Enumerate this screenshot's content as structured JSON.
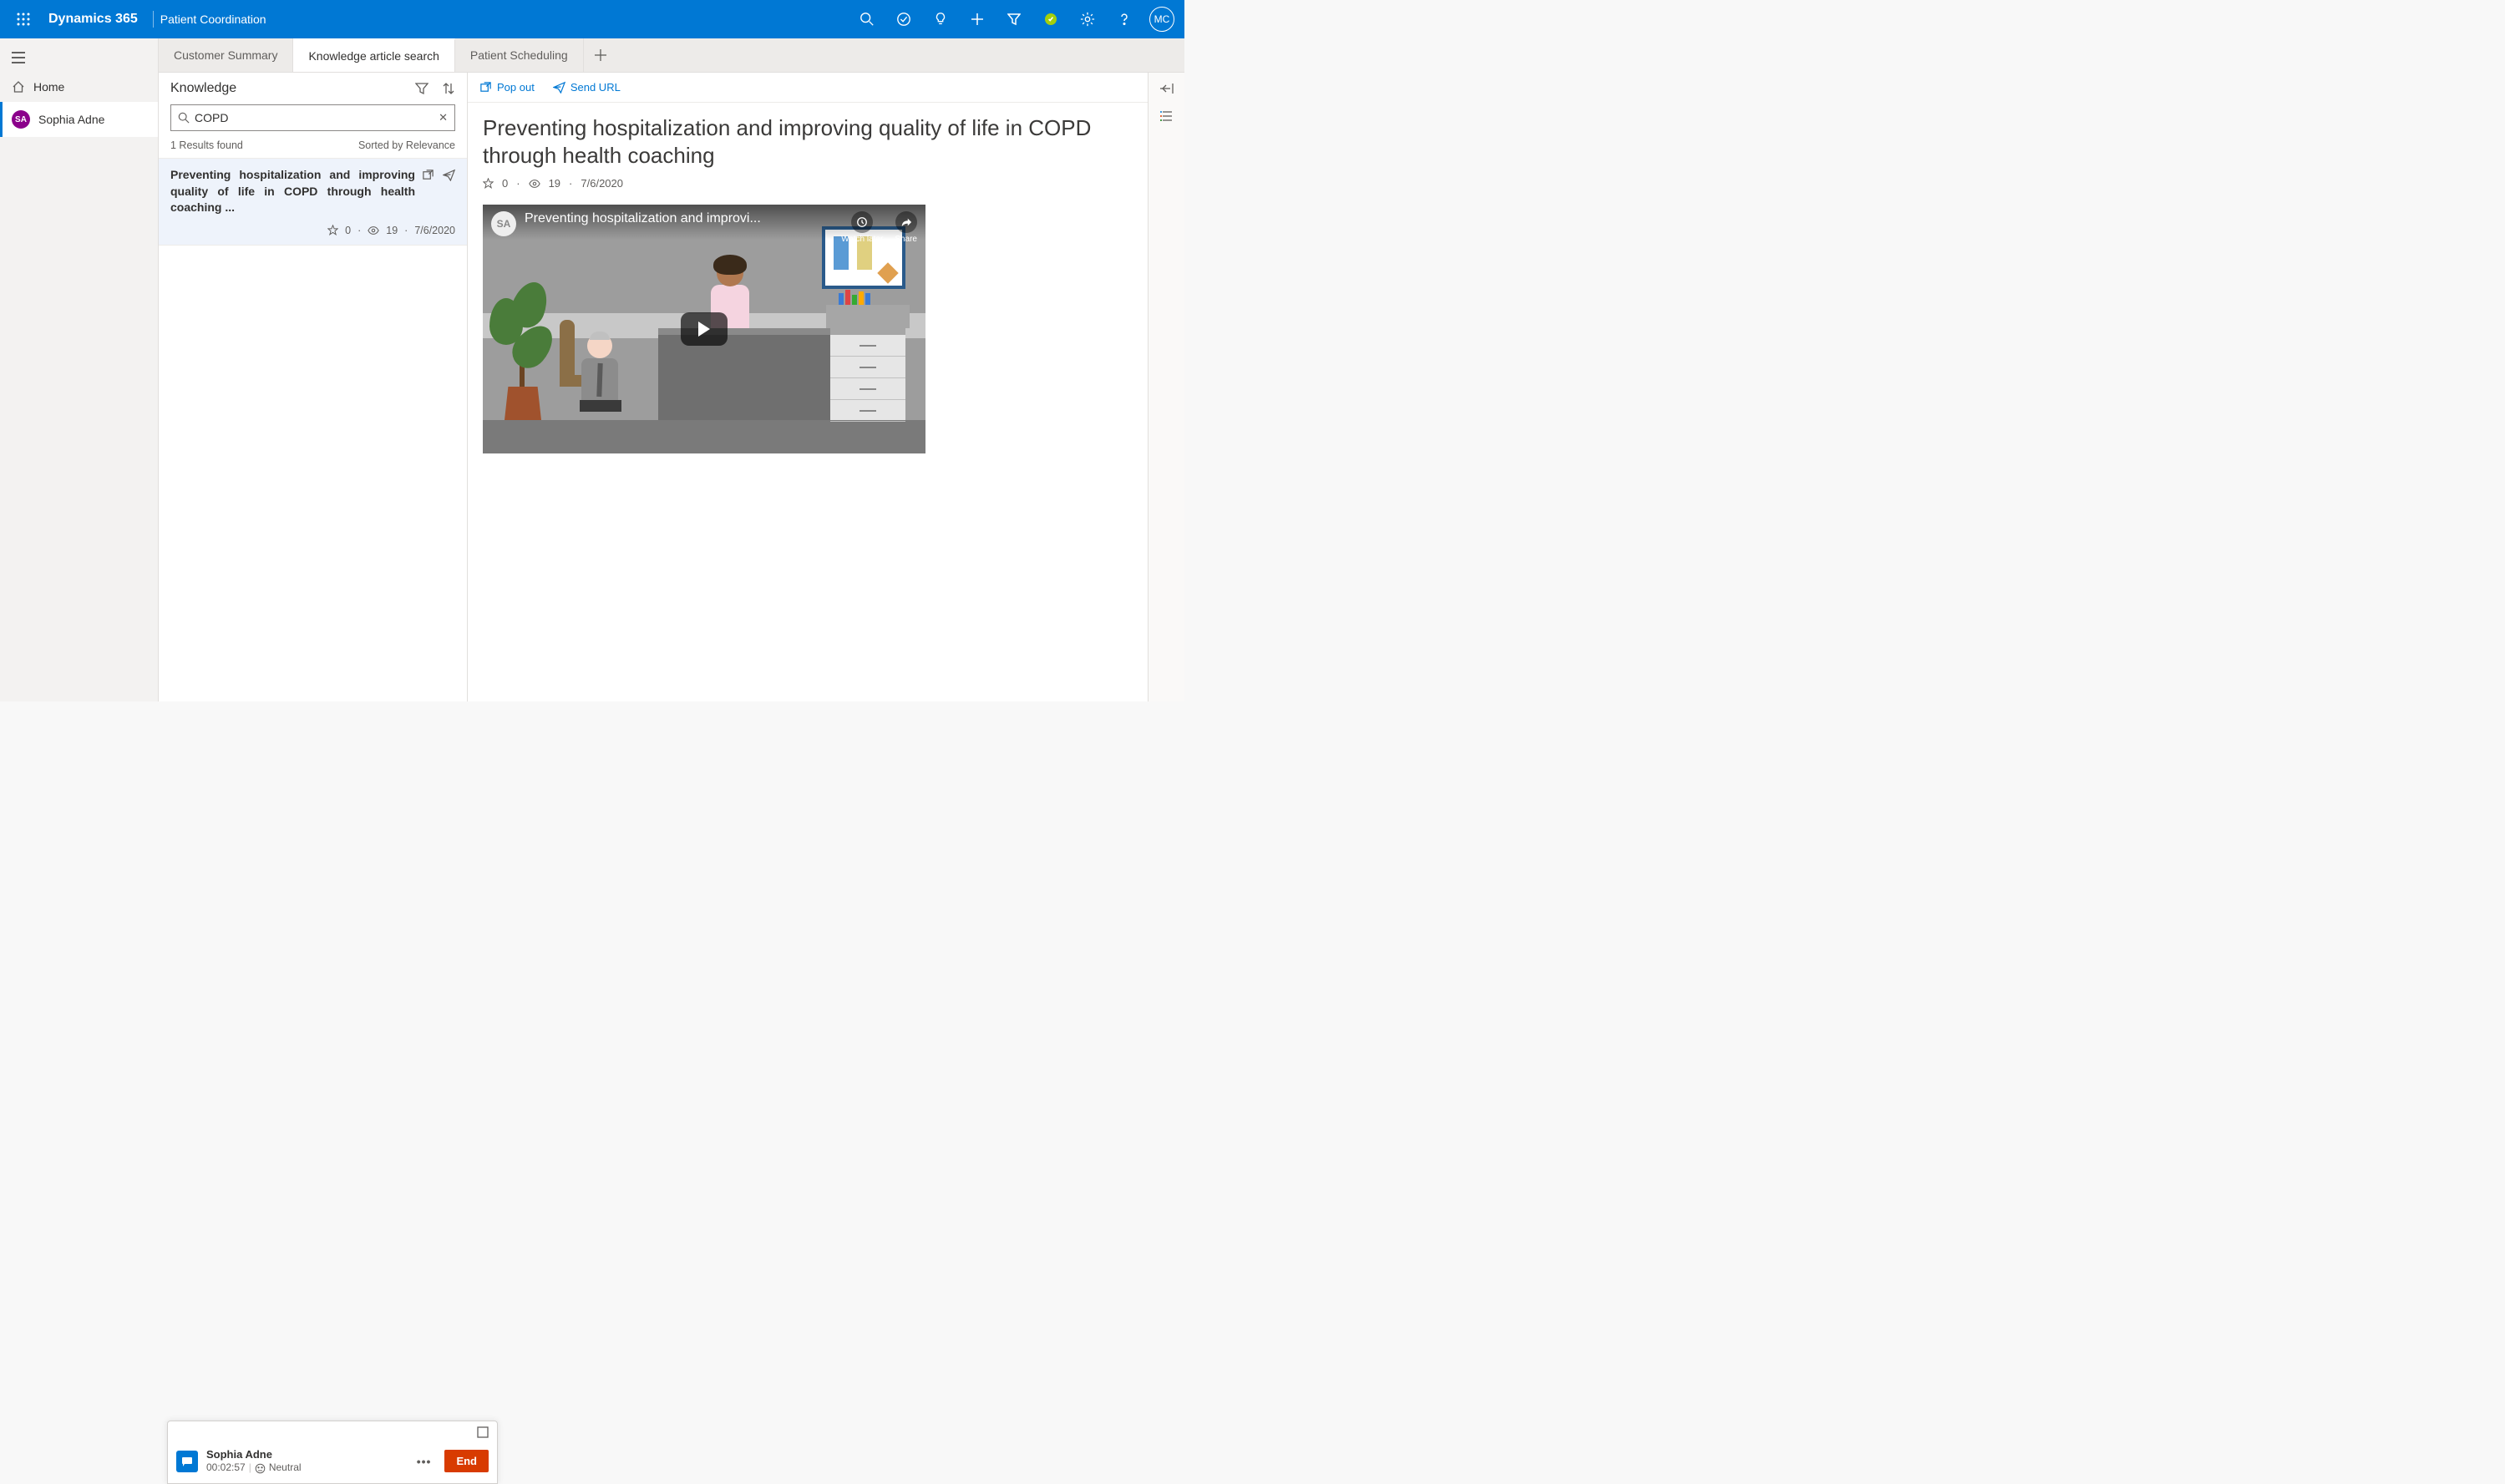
{
  "topbar": {
    "brand": "Dynamics 365",
    "app": "Patient Coordination",
    "user_initials": "MC"
  },
  "sidebar": {
    "home": "Home",
    "patient_initials": "SA",
    "patient_name": "Sophia Adne"
  },
  "tabs": {
    "t1": "Customer Summary",
    "t2": "Knowledge article search",
    "t3": "Patient Scheduling"
  },
  "knowledge": {
    "title": "Knowledge",
    "search_value": "COPD",
    "results_found": "1 Results found",
    "sorted": "Sorted by Relevance",
    "result": {
      "title": "Preventing hospitalization and improving quality of life in COPD through health coaching  ...",
      "rating": "0",
      "views": "19",
      "date": "7/6/2020"
    }
  },
  "article": {
    "actions": {
      "popout": "Pop out",
      "sendurl": "Send URL"
    },
    "title": "Preventing hospitalization and improving quality of life in COPD through health coaching",
    "rating": "0",
    "views": "19",
    "date": "7/6/2020",
    "video": {
      "avatar": "SA",
      "title": "Preventing hospitalization and improvi...",
      "watch_later": "Watch later",
      "share": "Share"
    }
  },
  "conversation": {
    "name": "Sophia Adne",
    "timer": "00:02:57",
    "sentiment": "Neutral",
    "end": "End"
  }
}
